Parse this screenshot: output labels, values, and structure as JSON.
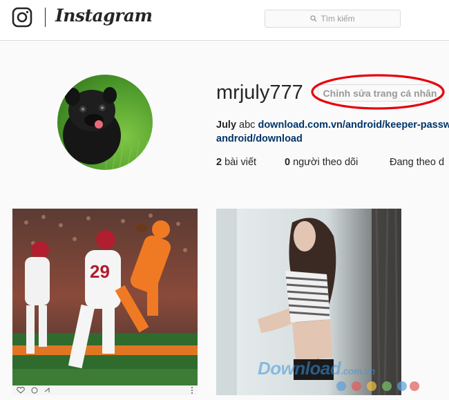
{
  "header": {
    "logo_icon": "instagram-camera-icon",
    "wordmark": "Instagram",
    "search_placeholder": "Tìm kiếm",
    "search_icon": "search-icon"
  },
  "profile": {
    "username": "mrjuly777",
    "edit_button": "Chỉnh sửa trang cá nhân",
    "highlight_color": "#e8000b",
    "bio_name": "July",
    "bio_text": "abc",
    "bio_link_line1": "download.com.vn/android/keeper-passw",
    "bio_link_line2": "android/download",
    "stats": {
      "posts_count": "2",
      "posts_label": "bài viết",
      "followers_count": "0",
      "followers_label": "người theo dõi",
      "following_label": "Đang theo d"
    }
  },
  "posts": [
    {
      "description_icon": "football-photo"
    },
    {
      "description_icon": "woman-photo"
    }
  ],
  "watermark": {
    "text": "Download",
    "suffix": ".com.vn"
  }
}
